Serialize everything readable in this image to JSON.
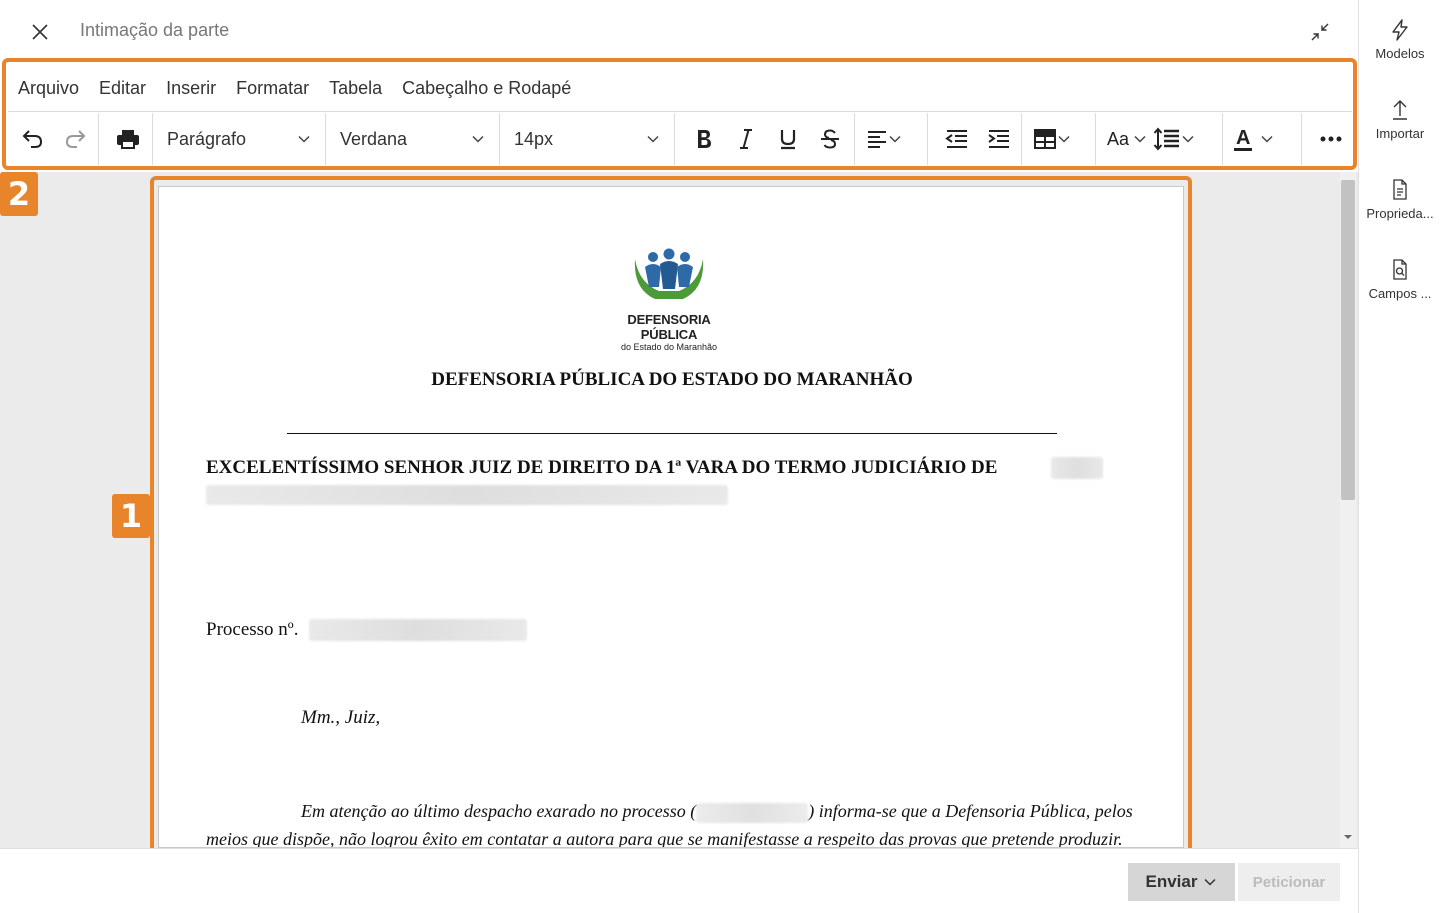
{
  "header": {
    "title": "Intimação da parte"
  },
  "sidebar": {
    "items": [
      {
        "label": "Modelos",
        "icon": "lightning-icon"
      },
      {
        "label": "Importar",
        "icon": "upload-icon"
      },
      {
        "label": "Proprieda...",
        "icon": "document-properties-icon"
      },
      {
        "label": "Campos ...",
        "icon": "document-search-icon"
      }
    ]
  },
  "menubar": {
    "items": [
      "Arquivo",
      "Editar",
      "Inserir",
      "Formatar",
      "Tabela",
      "Cabeçalho e Rodapé"
    ]
  },
  "toolbar": {
    "block_format": "Parágrafo",
    "font_family": "Verdana",
    "font_size": "14px",
    "font_case_label": "Aa",
    "text_color_label": "A"
  },
  "callouts": {
    "document_badge": "1",
    "toolbar_badge": "2",
    "accent_color": "#e8842a"
  },
  "document": {
    "logo_line1": "DEFENSORIA PÚBLICA",
    "logo_line2": "do Estado do Maranhão",
    "organization": "DEFENSORIA PÚBLICA DO ESTADO DO MARANHÃO",
    "addressee": "EXCELENTÍSSIMO SENHOR JUIZ DE DIREITO DA 1ª VARA DO TERMO JUDICIÁRIO DE",
    "process_label": "Processo nº.",
    "greeting": "Mm., Juiz,",
    "paragraph_start": "Em atenção ao último despacho exarado no processo (",
    "paragraph_end": ") informa-se que a Defensoria Pública, pelos meios que dispõe, não logrou êxito em contatar a autora para que se manifestasse a respeito das provas que pretende produzir."
  },
  "footer": {
    "send_label": "Enviar",
    "file_label": "Peticionar"
  }
}
